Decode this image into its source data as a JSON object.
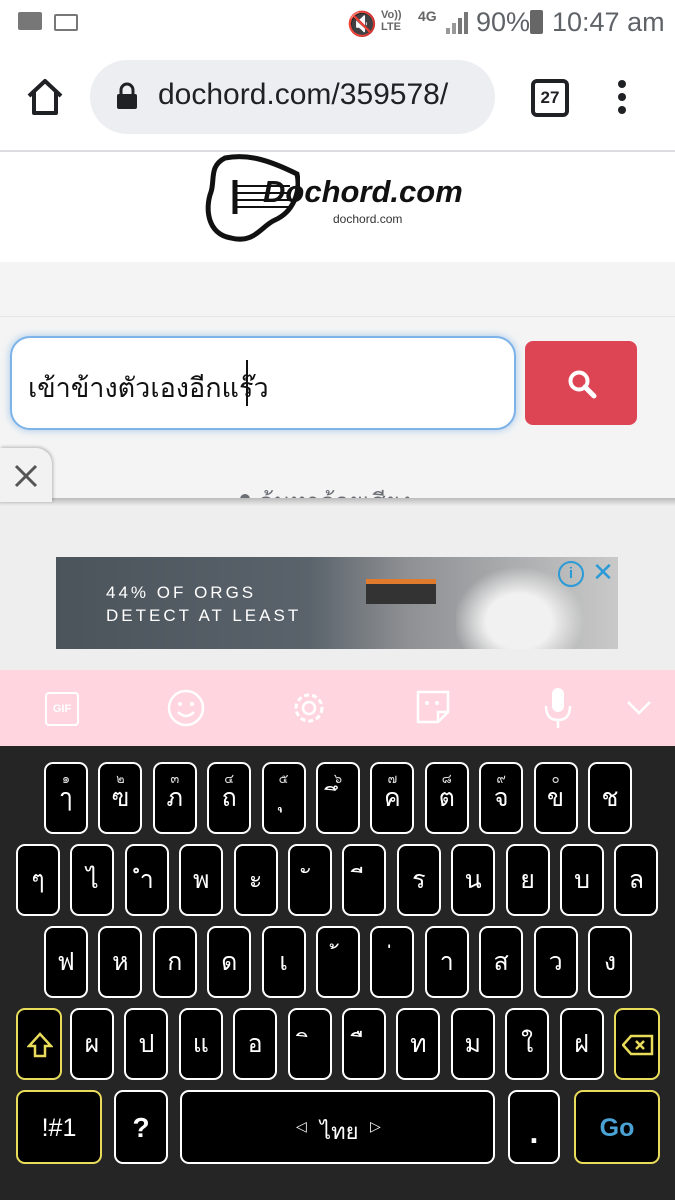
{
  "status_bar": {
    "battery": "90%",
    "time": "10:47 am",
    "network": "4G"
  },
  "browser": {
    "url": "dochord.com/359578/",
    "tab_count": "27"
  },
  "site": {
    "logo_text": "Dochord.com",
    "logo_sub": "dochord.com"
  },
  "search": {
    "value": "เข้าข้างตัวเองอีกแร๊ว",
    "voice_label": "ค้นหาด้วยเสียง"
  },
  "ad": {
    "line1": "44% OF ORGS",
    "line2": "DETECT AT LEAST"
  },
  "keyboard": {
    "row1": [
      {
        "k": "ๅ",
        "h": "๑"
      },
      {
        "k": "ฃ",
        "h": "๒"
      },
      {
        "k": "ภ",
        "h": "๓"
      },
      {
        "k": "ถ",
        "h": "๔"
      },
      {
        "k": "ุ",
        "h": "๕"
      },
      {
        "k": "ึ",
        "h": "๖"
      },
      {
        "k": "ค",
        "h": "๗"
      },
      {
        "k": "ต",
        "h": "๘"
      },
      {
        "k": "จ",
        "h": "๙"
      },
      {
        "k": "ข",
        "h": "๐"
      },
      {
        "k": "ช",
        "h": ""
      }
    ],
    "row2": [
      "ๆ",
      "ไ",
      "ำ",
      "พ",
      "ะ",
      "ั",
      "ี",
      "ร",
      "น",
      "ย",
      "บ",
      "ล"
    ],
    "row3": [
      "ฟ",
      "ห",
      "ก",
      "ด",
      "เ",
      "้",
      "่",
      "า",
      "ส",
      "ว",
      "ง"
    ],
    "row4": [
      "ผ",
      "ป",
      "แ",
      "อ",
      "ิ",
      "ื",
      "ท",
      "ม",
      "ใ",
      "ฝ"
    ],
    "sym_label": "!#1",
    "question": "?",
    "space_label": "ไทย",
    "period": ".",
    "go_label": "Go"
  },
  "colors": {
    "search_button": "#de4554",
    "keyboard_toolbar": "#ffd5df",
    "go": "#4aa3d4"
  }
}
